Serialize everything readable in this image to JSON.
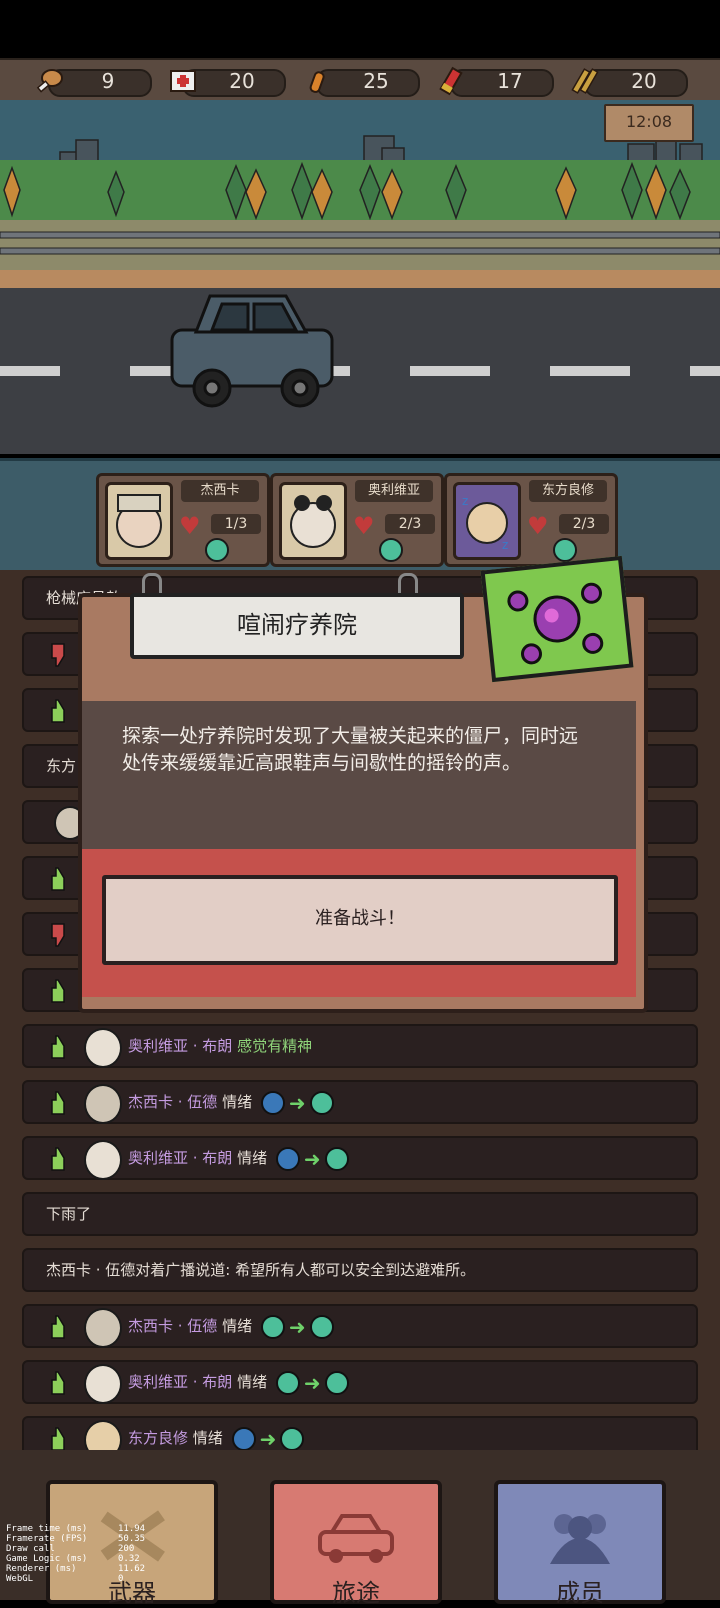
{
  "resources": [
    {
      "icon": "meat-icon",
      "value": "9"
    },
    {
      "icon": "medkit-icon",
      "value": "20"
    },
    {
      "icon": "bullet-icon",
      "value": "25"
    },
    {
      "icon": "shotgun-shell-icon",
      "value": "17"
    },
    {
      "icon": "rifle-ammo-icon",
      "value": "20"
    }
  ],
  "clock": "12:08",
  "party": [
    {
      "name": "杰西卡",
      "hp": "1/3"
    },
    {
      "name": "奥利维亚",
      "hp": "2/3"
    },
    {
      "name": "东方良修",
      "hp": "2/3"
    }
  ],
  "log": {
    "partial_row_1": "枪械店员敖",
    "partial_row_4": "东方",
    "row_olivia_energetic": {
      "name": "奥利维亚 · 布朗",
      "text": "感觉有精神"
    },
    "row_jessica_mood_1": {
      "name": "杰西卡 · 伍德",
      "label": "情绪"
    },
    "row_olivia_mood_1": {
      "name": "奥利维亚 · 布朗",
      "label": "情绪"
    },
    "rain": "下雨了",
    "broadcast": "杰西卡 · 伍德对着广播说道: 希望所有人都可以安全到达避难所。",
    "row_jessica_mood_2": {
      "name": "杰西卡 · 伍德",
      "label": "情绪"
    },
    "row_olivia_mood_2": {
      "name": "奥利维亚 · 布朗",
      "label": "情绪"
    },
    "row_dongfang_mood": {
      "name": "东方良修",
      "label": "情绪"
    }
  },
  "event": {
    "title": "喧闹疗养院",
    "description": "探索一处疗养院时发现了大量被关起来的僵尸，同时远处传来缓缓靠近高跟鞋声与间歇性的摇铃的声。",
    "button": "准备战斗！"
  },
  "nav": {
    "weapons": "武器",
    "journey": "旅途",
    "members": "成员"
  },
  "debug": [
    {
      "label": "Frame time (ms)",
      "value": "11.94"
    },
    {
      "label": "Framerate (FPS)",
      "value": "50.35"
    },
    {
      "label": "Draw call",
      "value": "200"
    },
    {
      "label": "Game Logic (ms)",
      "value": "0.32"
    },
    {
      "label": "Renderer (ms)",
      "value": "11.62"
    },
    {
      "label": "WebGL",
      "value": "0"
    }
  ],
  "colors": {
    "mood_happy": "#4dbf9a",
    "mood_sad": "#3a78b8",
    "arrow": "#6fd16a",
    "name_purple": "#c49be0"
  }
}
